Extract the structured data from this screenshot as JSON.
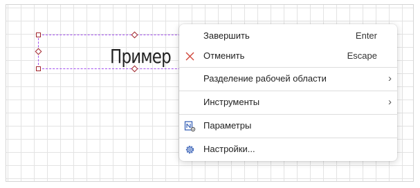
{
  "canvas": {
    "shape_text": "Пример"
  },
  "context_menu": {
    "items": [
      {
        "label": "Завершить",
        "shortcut": "Enter",
        "icon": ""
      },
      {
        "label": "Отменить",
        "shortcut": "Escape",
        "icon": "close-icon"
      },
      {
        "label": "Разделение рабочей области",
        "submenu": true
      },
      {
        "label": "Инструменты",
        "submenu": true
      },
      {
        "label": "Параметры",
        "icon": "parameters-icon"
      },
      {
        "label": "Настройки...",
        "icon": "gear-icon"
      }
    ],
    "submenu_glyph": "›"
  },
  "colors": {
    "selection": "#a24ef0",
    "handle": "#a0242b",
    "cancel_icon": "#d0463a",
    "icon_blue": "#3a63b8"
  }
}
